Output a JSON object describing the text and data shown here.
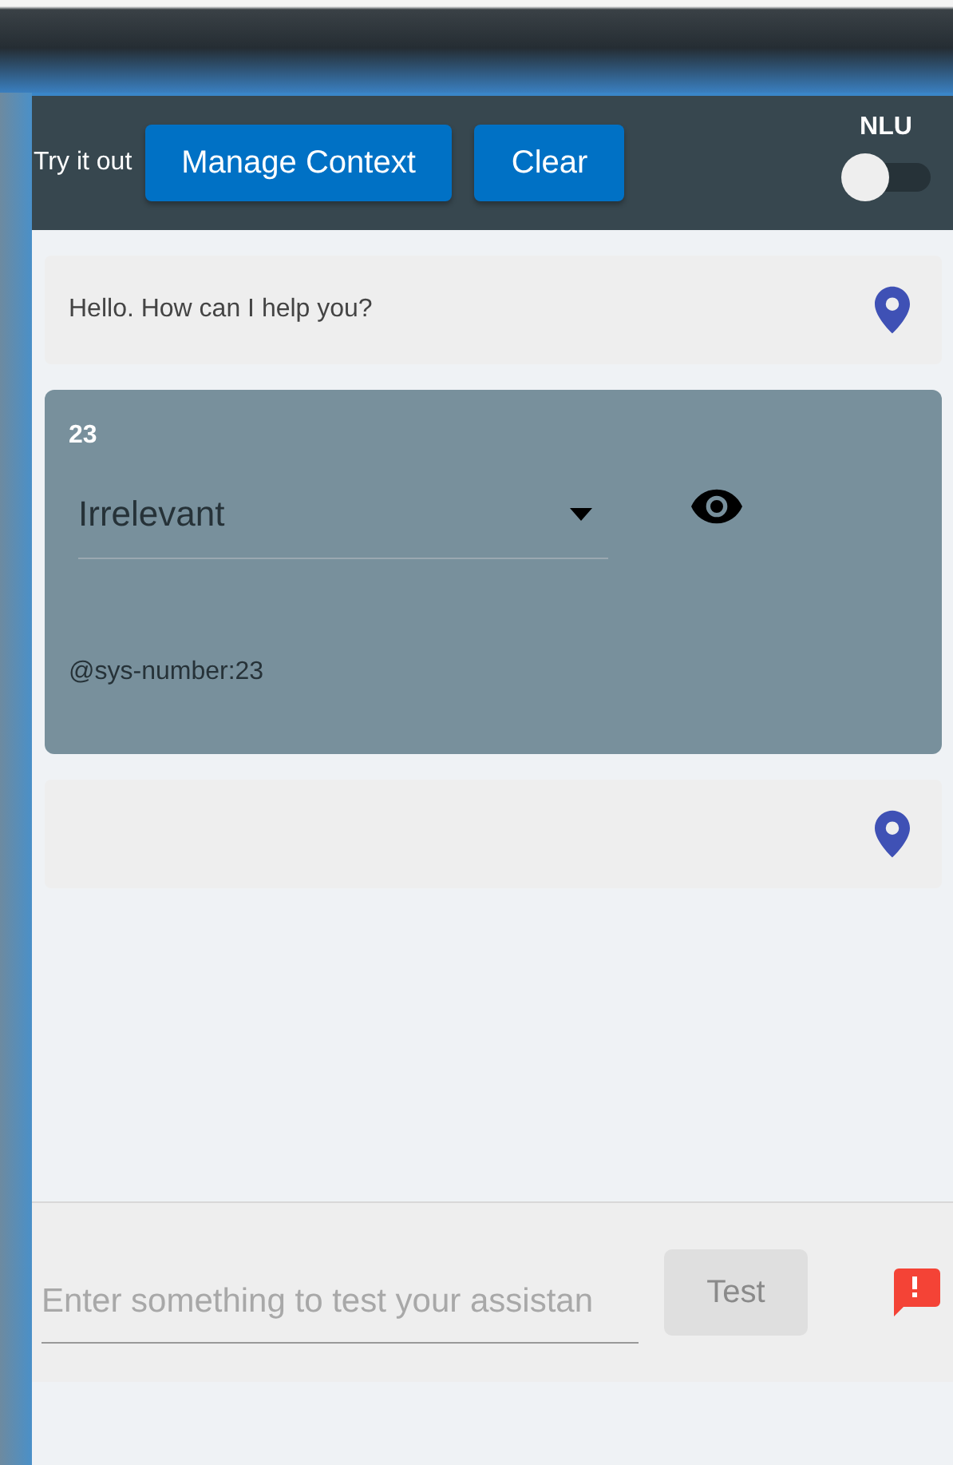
{
  "header": {
    "title": "Try it out",
    "buttons": [
      {
        "label": "Manage Context"
      },
      {
        "label": "Clear"
      }
    ],
    "nlu_toggle": {
      "label": "NLU",
      "on": false
    }
  },
  "messages": [
    {
      "kind": "bot",
      "text": "Hello. How can I help you?"
    },
    {
      "kind": "user",
      "text": "23",
      "intent": "Irrelevant",
      "entities": "@sys-number:23"
    },
    {
      "kind": "bot"
    }
  ],
  "input": {
    "placeholder": "Enter something to test your assistan",
    "test_button": {
      "label": "Test",
      "disabled": true
    }
  }
}
